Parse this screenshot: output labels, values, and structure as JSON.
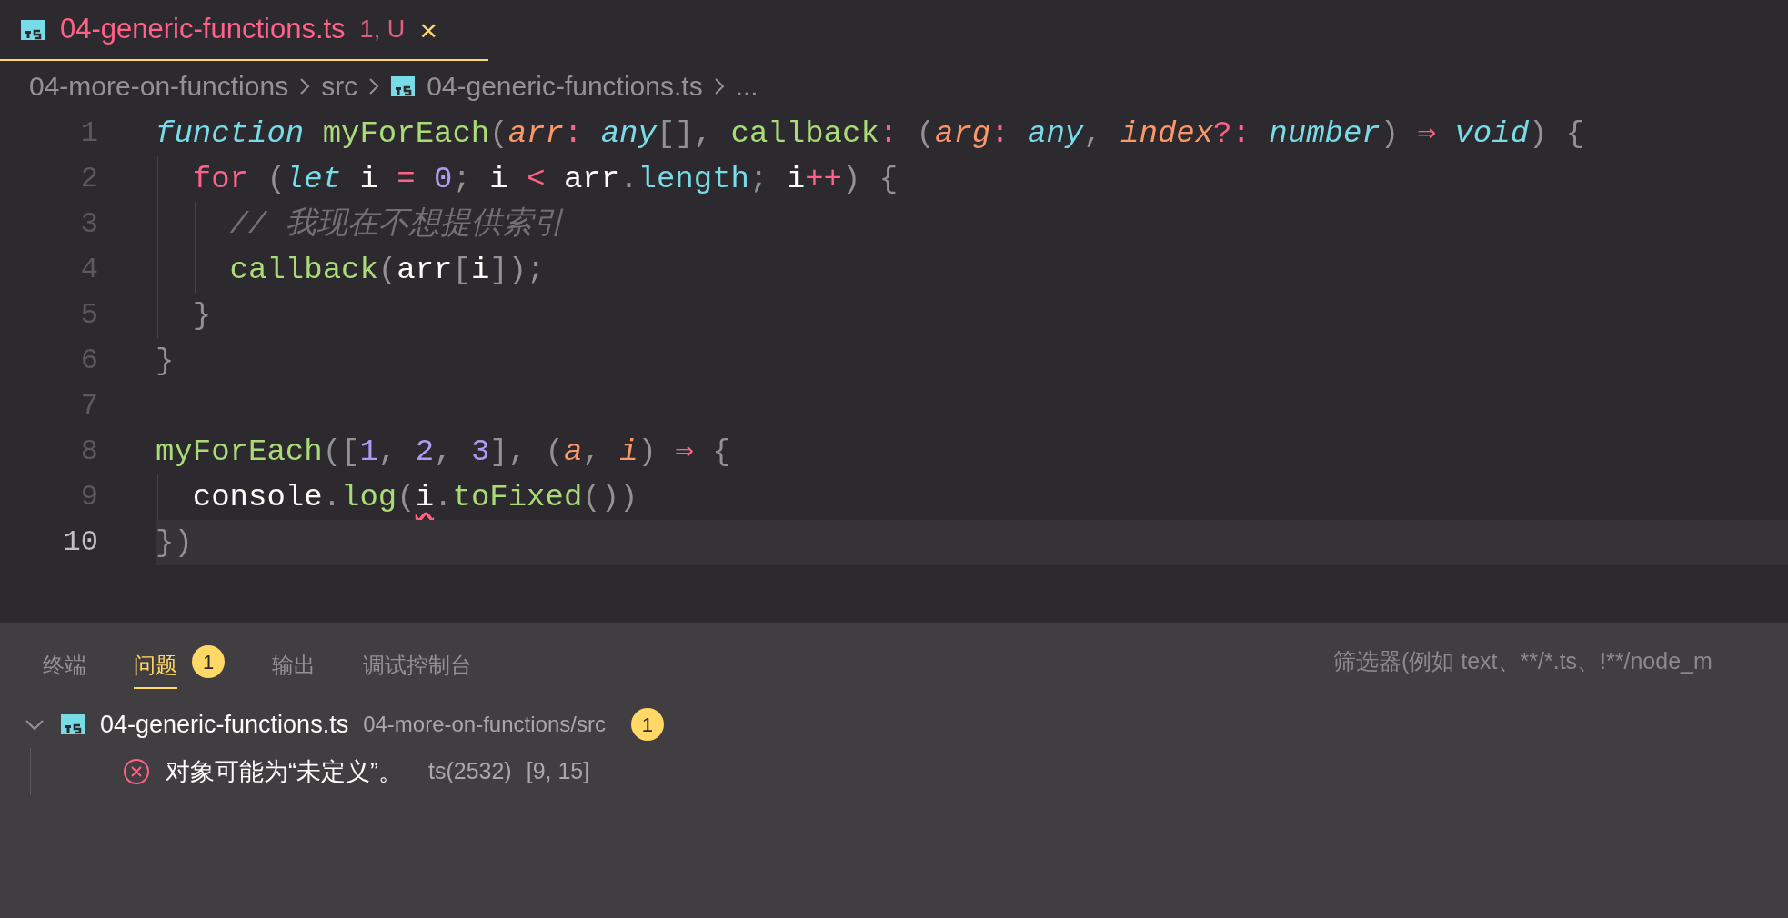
{
  "tab": {
    "title": "04-generic-functions.ts",
    "status": "1, U",
    "close": "×",
    "selected": true
  },
  "breadcrumb": {
    "items": [
      "04-more-on-functions",
      "src",
      "04-generic-functions.ts",
      "..."
    ]
  },
  "editor": {
    "lines": [
      {
        "number": "1",
        "current": false,
        "tokens": [
          {
            "text": "function ",
            "color": "#78dce8",
            "italic": true
          },
          {
            "text": "myForEach",
            "color": "#a9dc76"
          },
          {
            "text": "(",
            "color": "#939293"
          },
          {
            "text": "arr",
            "color": "#fc9867",
            "italic": true
          },
          {
            "text": ": ",
            "color": "#ff6188"
          },
          {
            "text": "any",
            "color": "#78dce8",
            "italic": true
          },
          {
            "text": "[], ",
            "color": "#939293"
          },
          {
            "text": "callback",
            "color": "#a9dc76"
          },
          {
            "text": ": ",
            "color": "#ff6188"
          },
          {
            "text": "(",
            "color": "#939293"
          },
          {
            "text": "arg",
            "color": "#fc9867",
            "italic": true
          },
          {
            "text": ": ",
            "color": "#ff6188"
          },
          {
            "text": "any",
            "color": "#78dce8",
            "italic": true
          },
          {
            "text": ", ",
            "color": "#939293"
          },
          {
            "text": "index",
            "color": "#fc9867",
            "italic": true
          },
          {
            "text": "?: ",
            "color": "#ff6188"
          },
          {
            "text": "number",
            "color": "#78dce8",
            "italic": true
          },
          {
            "text": ") ",
            "color": "#939293"
          },
          {
            "text": "⇒ ",
            "color": "#ff6188"
          },
          {
            "text": "void",
            "color": "#78dce8",
            "italic": true
          },
          {
            "text": ") {",
            "color": "#939293"
          }
        ]
      },
      {
        "number": "2",
        "current": false,
        "tokens": [
          {
            "text": "  for",
            "color": "#ff6188"
          },
          {
            "text": " (",
            "color": "#939293"
          },
          {
            "text": "let",
            "color": "#78dce8",
            "italic": true
          },
          {
            "text": " i ",
            "color": "#fcfcfa"
          },
          {
            "text": "= ",
            "color": "#ff6188"
          },
          {
            "text": "0",
            "color": "#ab9df2"
          },
          {
            "text": "; ",
            "color": "#939293"
          },
          {
            "text": "i ",
            "color": "#fcfcfa"
          },
          {
            "text": "< ",
            "color": "#ff6188"
          },
          {
            "text": "arr",
            "color": "#fcfcfa"
          },
          {
            "text": ".",
            "color": "#939293"
          },
          {
            "text": "length",
            "color": "#78dce8"
          },
          {
            "text": "; ",
            "color": "#939293"
          },
          {
            "text": "i",
            "color": "#fcfcfa"
          },
          {
            "text": "++",
            "color": "#ff6188"
          },
          {
            "text": ") {",
            "color": "#939293"
          }
        ]
      },
      {
        "number": "3",
        "current": false,
        "tokens": [
          {
            "text": "    // 我现在不想提供索引",
            "color": "#727072",
            "italic": true
          }
        ]
      },
      {
        "number": "4",
        "current": false,
        "tokens": [
          {
            "text": "    callback",
            "color": "#a9dc76"
          },
          {
            "text": "(",
            "color": "#939293"
          },
          {
            "text": "arr",
            "color": "#fcfcfa"
          },
          {
            "text": "[",
            "color": "#939293"
          },
          {
            "text": "i",
            "color": "#fcfcfa"
          },
          {
            "text": "]);",
            "color": "#939293"
          }
        ]
      },
      {
        "number": "5",
        "current": false,
        "tokens": [
          {
            "text": "  }",
            "color": "#939293"
          }
        ]
      },
      {
        "number": "6",
        "current": false,
        "tokens": [
          {
            "text": "}",
            "color": "#939293"
          }
        ]
      },
      {
        "number": "7",
        "current": false
      },
      {
        "number": "8",
        "current": false,
        "tokens": [
          {
            "text": "myForEach",
            "color": "#a9dc76"
          },
          {
            "text": "([",
            "color": "#939293"
          },
          {
            "text": "1",
            "color": "#ab9df2"
          },
          {
            "text": ", ",
            "color": "#939293"
          },
          {
            "text": "2",
            "color": "#ab9df2"
          },
          {
            "text": ", ",
            "color": "#939293"
          },
          {
            "text": "3",
            "color": "#ab9df2"
          },
          {
            "text": "], (",
            "color": "#939293"
          },
          {
            "text": "a",
            "color": "#fc9867",
            "italic": true
          },
          {
            "text": ", ",
            "color": "#939293"
          },
          {
            "text": "i",
            "color": "#fc9867",
            "italic": true
          },
          {
            "text": ") ",
            "color": "#939293"
          },
          {
            "text": "⇒ ",
            "color": "#ff6188"
          },
          {
            "text": "{",
            "color": "#939293"
          }
        ]
      },
      {
        "number": "9",
        "current": false,
        "tokens": [
          {
            "text": "  console",
            "color": "#fcfcfa"
          },
          {
            "text": ".",
            "color": "#939293"
          },
          {
            "text": "log",
            "color": "#a9dc76"
          },
          {
            "text": "(",
            "color": "#939293"
          },
          {
            "text": "i",
            "color": "#fcfcfa",
            "squiggle": true
          },
          {
            "text": ".",
            "color": "#939293"
          },
          {
            "text": "toFixed",
            "color": "#a9dc76"
          },
          {
            "text": "())",
            "color": "#939293"
          }
        ]
      },
      {
        "number": "10",
        "current": true,
        "tokens": [
          {
            "text": "})",
            "color": "#939293"
          }
        ]
      }
    ]
  },
  "panel": {
    "tabs": [
      {
        "label": "终端",
        "selected": false
      },
      {
        "label": "问题",
        "selected": true,
        "badge": "1"
      },
      {
        "label": "输出",
        "selected": false
      },
      {
        "label": "调试控制台",
        "selected": false
      }
    ],
    "filter": {
      "placeholder": "筛选器(例如 text、**/*.ts、!**/node_m"
    },
    "files": [
      {
        "name": "04-generic-functions.ts",
        "path": "04-more-on-functions/src",
        "count": "1",
        "expanded": true,
        "problems": [
          {
            "message": "对象可能为“未定义”。",
            "code": "ts(2532)",
            "position": "[9, 15]"
          }
        ]
      }
    ]
  }
}
